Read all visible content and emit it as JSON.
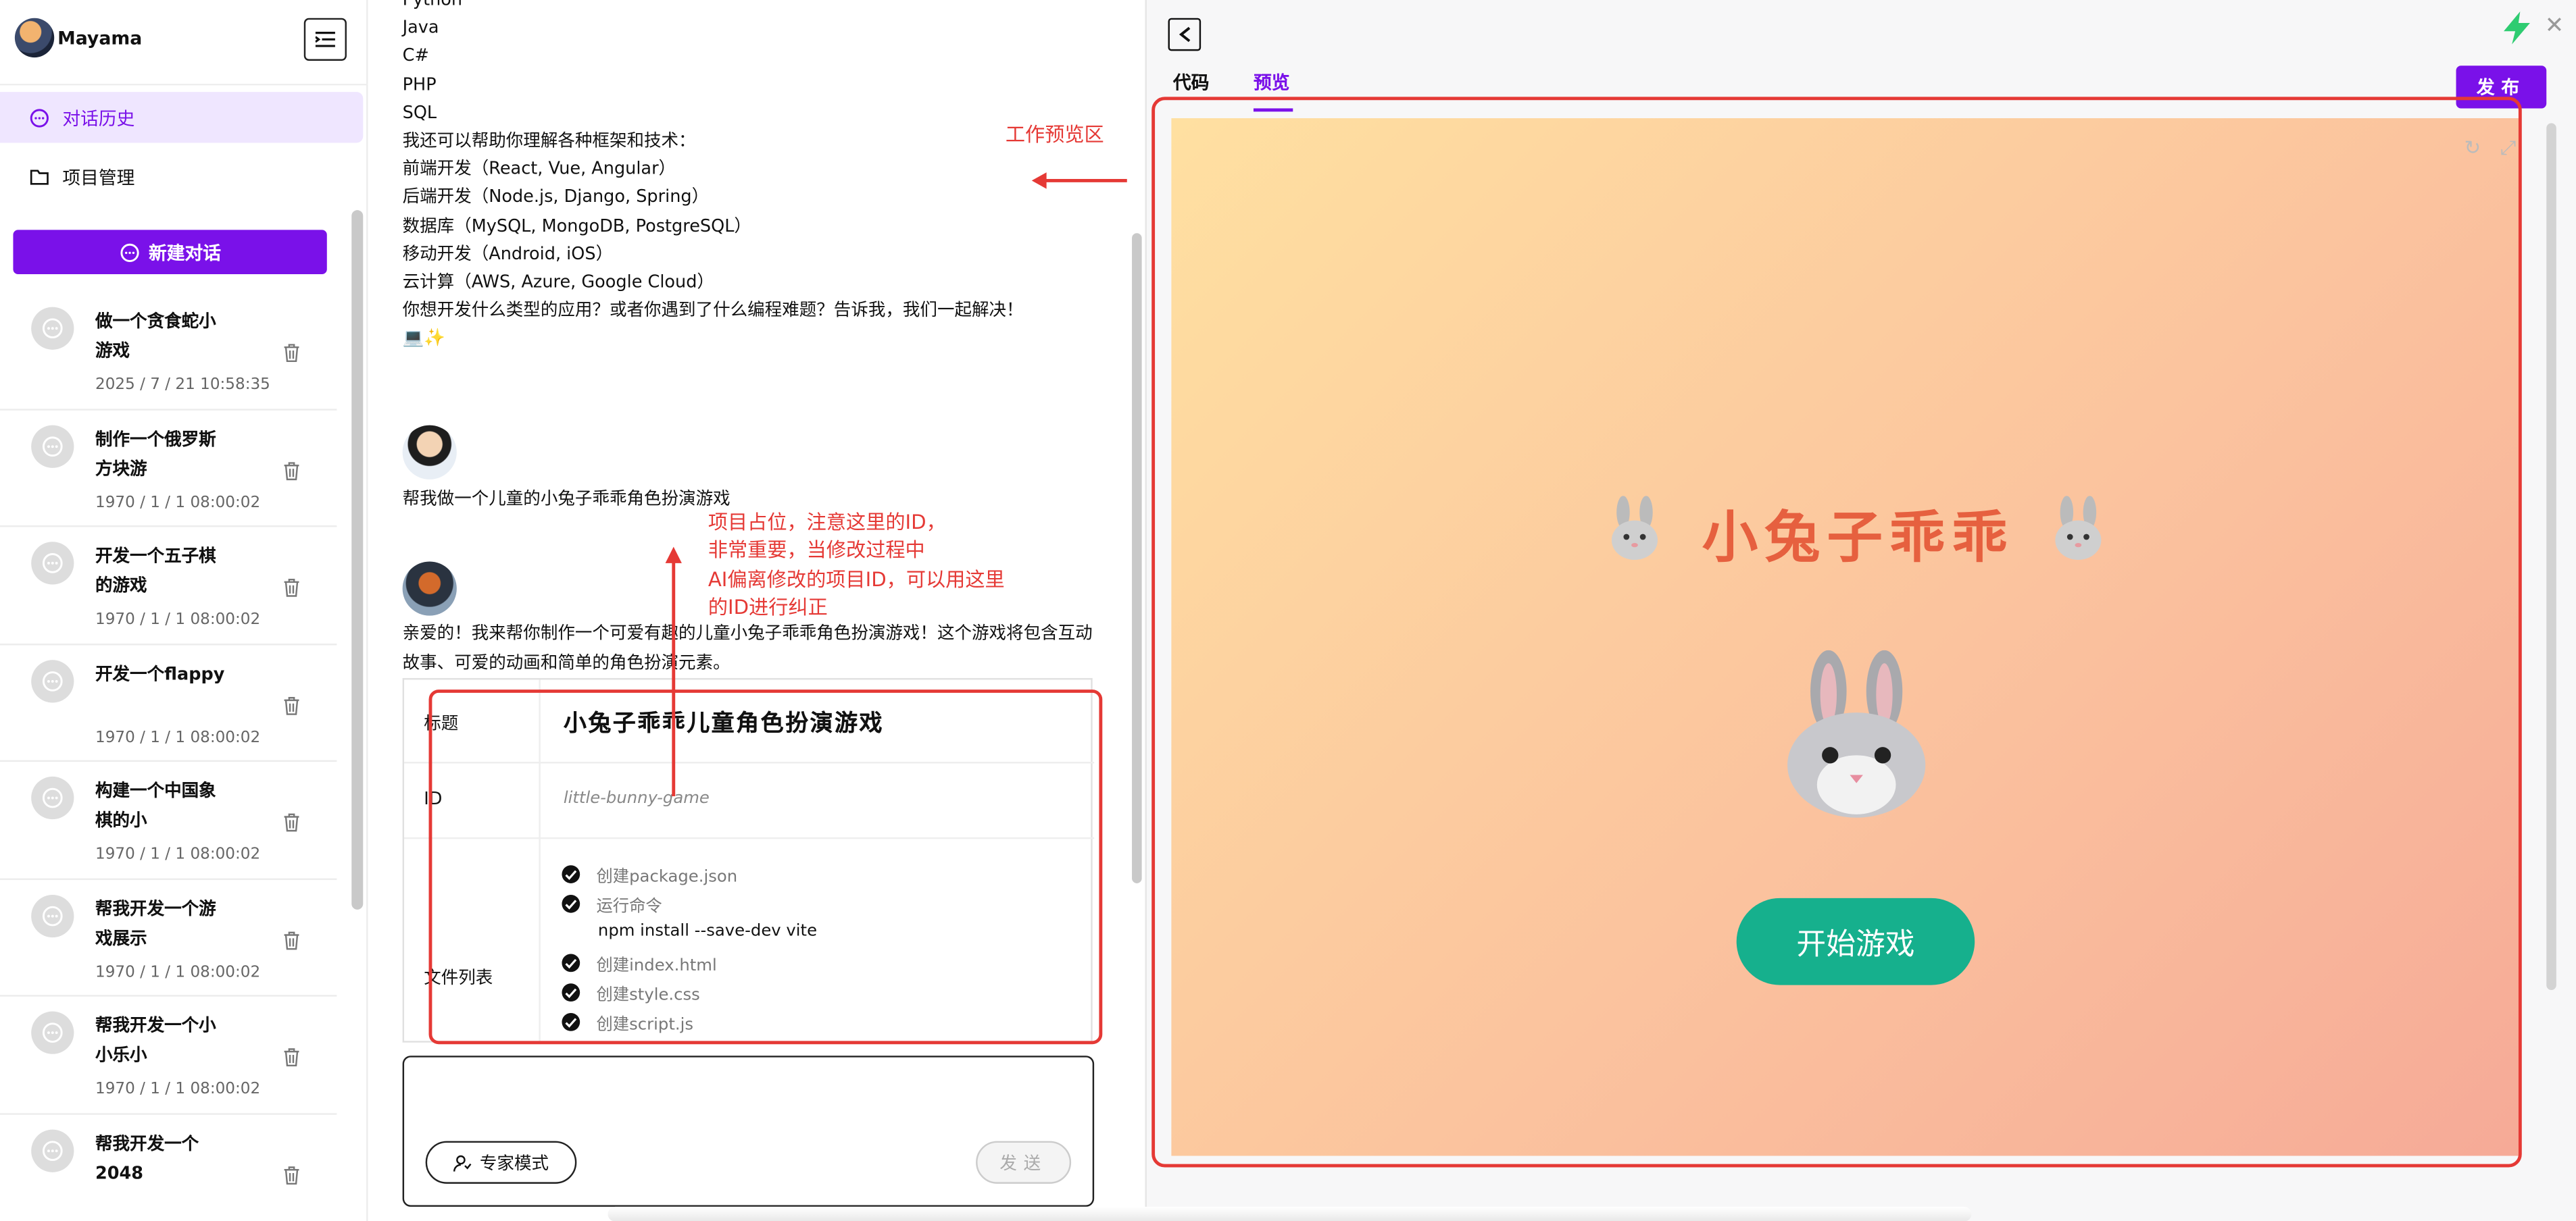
{
  "sidebar": {
    "app_name": "Mayama",
    "nav": {
      "history": "对话历史",
      "projects": "项目管理"
    },
    "new_chat": "新建对话",
    "items": [
      {
        "title": "做一个贪食蛇小游戏",
        "date": "2025 / 7 / 21 10:58:35"
      },
      {
        "title": "制作一个俄罗斯方块游",
        "date": "1970 / 1 / 1 08:00:02"
      },
      {
        "title": "开发一个五子棋的游戏",
        "date": "1970 / 1 / 1 08:00:02"
      },
      {
        "title": "开发一个flappy",
        "date": "1970 / 1 / 1 08:00:02"
      },
      {
        "title": "构建一个中国象棋的小",
        "date": "1970 / 1 / 1 08:00:02"
      },
      {
        "title": "帮我开发一个游戏展示",
        "date": "1970 / 1 / 1 08:00:02"
      },
      {
        "title": "帮我开发一个小小乐小",
        "date": "1970 / 1 / 1 08:00:02"
      },
      {
        "title": "帮我开发一个2048",
        "date": ""
      }
    ]
  },
  "chat": {
    "lines": [
      "Python",
      "Java",
      "C#",
      "PHP",
      "SQL",
      "我还可以帮助你理解各种框架和技术：",
      "前端开发（React, Vue, Angular）",
      "后端开发（Node.js, Django, Spring）",
      "数据库（MySQL, MongoDB, PostgreSQL）",
      "移动开发（Android, iOS）",
      "云计算（AWS, Azure, Google Cloud）",
      "你想开发什么类型的应用？或者你遇到了什么编程难题？告诉我，我们一起解决！",
      "💻✨"
    ],
    "user_message": "帮我做一个儿童的小兔子乖乖角色扮演游戏",
    "ai_message": "亲爱的！我来帮你制作一个可爱有趣的儿童小兔子乖乖角色扮演游戏！这个游戏将包含互动故事、可爱的动画和简单的角色扮演元素。",
    "card": {
      "title_label": "标题",
      "title_value": "小兔子乖乖儿童角色扮演游戏",
      "id_label": "ID",
      "id_value": "little-bunny-game",
      "files_label": "文件列表",
      "files": [
        "创建package.json",
        "运行命令",
        "创建index.html",
        "创建style.css",
        "创建script.js"
      ],
      "command": "npm install --save-dev vite"
    },
    "expert_mode": "专家模式",
    "send": "发送"
  },
  "annotations": {
    "preview_area": "工作预览区",
    "id_note": [
      "项目占位，注意这里的ID，",
      "非常重要，当修改过程中",
      "AI偏离修改的项目ID，可以用这里",
      "的ID进行纠正"
    ]
  },
  "pane": {
    "tabs": {
      "code": "代码",
      "preview": "预览"
    },
    "publish": "发布",
    "game": {
      "title": "小兔子乖乖",
      "bunny": "🐰",
      "start": "开始游戏"
    }
  },
  "colors": {
    "accent": "#7a11e9",
    "annotation": "#e53935",
    "start_button": "#16b08d"
  }
}
